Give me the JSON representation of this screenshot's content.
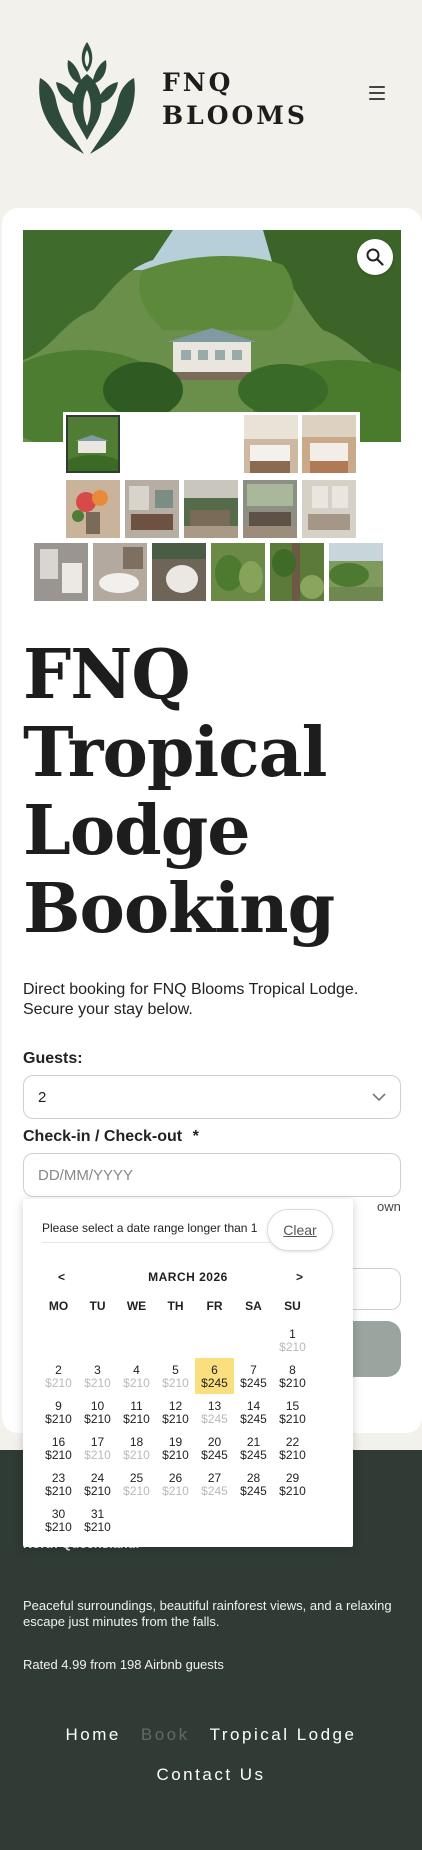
{
  "header": {
    "brand_line1": "FNQ",
    "brand_line2": "BLOOMS"
  },
  "colors": {
    "brand_green": "#2d4a3a",
    "footer_bg": "#2f3b34",
    "selected_day": "#fbdf7e",
    "page_bg": "#f3f1ec"
  },
  "gallery": {
    "zoom_icon": "magnifier-icon",
    "thumbnails": [
      "lodge-exterior",
      "bedroom-1",
      "bedroom-2",
      "flowers",
      "living-room",
      "veranda",
      "lounge",
      "bedroom-3",
      "bathroom",
      "bathtub",
      "spa",
      "garden",
      "rainforest",
      "riverside"
    ]
  },
  "main": {
    "title": "FNQ Tropical Lodge Booking",
    "intro": "Direct booking for FNQ Blooms Tropical Lodge. Secure your stay below.",
    "guests_label": "Guests:",
    "guests_value": "2",
    "dates_label": "Check-in / Check-out",
    "required_mark": "*",
    "dates_placeholder": "DD/MM/YYYY",
    "behind_text": "own"
  },
  "datepicker": {
    "message": "Please select a date range longer than 1",
    "clear_label": "Clear",
    "prev": "<",
    "next": ">",
    "month": "MARCH 2026",
    "weekdays": [
      "MO",
      "TU",
      "WE",
      "TH",
      "FR",
      "SA",
      "SU"
    ],
    "days": [
      {
        "d": "1",
        "p": "$210",
        "s": "dis"
      },
      {
        "d": "2",
        "p": "$210",
        "s": "dis"
      },
      {
        "d": "3",
        "p": "$210",
        "s": "dis"
      },
      {
        "d": "4",
        "p": "$210",
        "s": "dis"
      },
      {
        "d": "5",
        "p": "$210",
        "s": "dis"
      },
      {
        "d": "6",
        "p": "$245",
        "s": "sel"
      },
      {
        "d": "7",
        "p": "$245",
        "s": ""
      },
      {
        "d": "8",
        "p": "$210",
        "s": ""
      },
      {
        "d": "9",
        "p": "$210",
        "s": ""
      },
      {
        "d": "10",
        "p": "$210",
        "s": ""
      },
      {
        "d": "11",
        "p": "$210",
        "s": ""
      },
      {
        "d": "12",
        "p": "$210",
        "s": ""
      },
      {
        "d": "13",
        "p": "$245",
        "s": "dis"
      },
      {
        "d": "14",
        "p": "$245",
        "s": ""
      },
      {
        "d": "15",
        "p": "$210",
        "s": ""
      },
      {
        "d": "16",
        "p": "$210",
        "s": ""
      },
      {
        "d": "17",
        "p": "$210",
        "s": "dis"
      },
      {
        "d": "18",
        "p": "$210",
        "s": "dis"
      },
      {
        "d": "19",
        "p": "$210",
        "s": ""
      },
      {
        "d": "20",
        "p": "$245",
        "s": ""
      },
      {
        "d": "21",
        "p": "$245",
        "s": ""
      },
      {
        "d": "22",
        "p": "$210",
        "s": ""
      },
      {
        "d": "23",
        "p": "$210",
        "s": ""
      },
      {
        "d": "24",
        "p": "$210",
        "s": ""
      },
      {
        "d": "25",
        "p": "$210",
        "s": "dis"
      },
      {
        "d": "26",
        "p": "$210",
        "s": "dis"
      },
      {
        "d": "27",
        "p": "$245",
        "s": "dis"
      },
      {
        "d": "28",
        "p": "$245",
        "s": ""
      },
      {
        "d": "29",
        "p": "$210",
        "s": ""
      },
      {
        "d": "30",
        "p": "$210",
        "s": ""
      },
      {
        "d": "31",
        "p": "$210",
        "s": ""
      }
    ]
  },
  "footer": {
    "location_prefix": "",
    "location_bold": "North Queensland.",
    "description": "Peaceful surroundings, beautiful rainforest views, and a relaxing escape just minutes from the falls.",
    "rating": "Rated 4.99 from 198 Airbnb guests",
    "nav": [
      "Home",
      "Book",
      "Tropical Lodge",
      "Contact Us"
    ]
  }
}
